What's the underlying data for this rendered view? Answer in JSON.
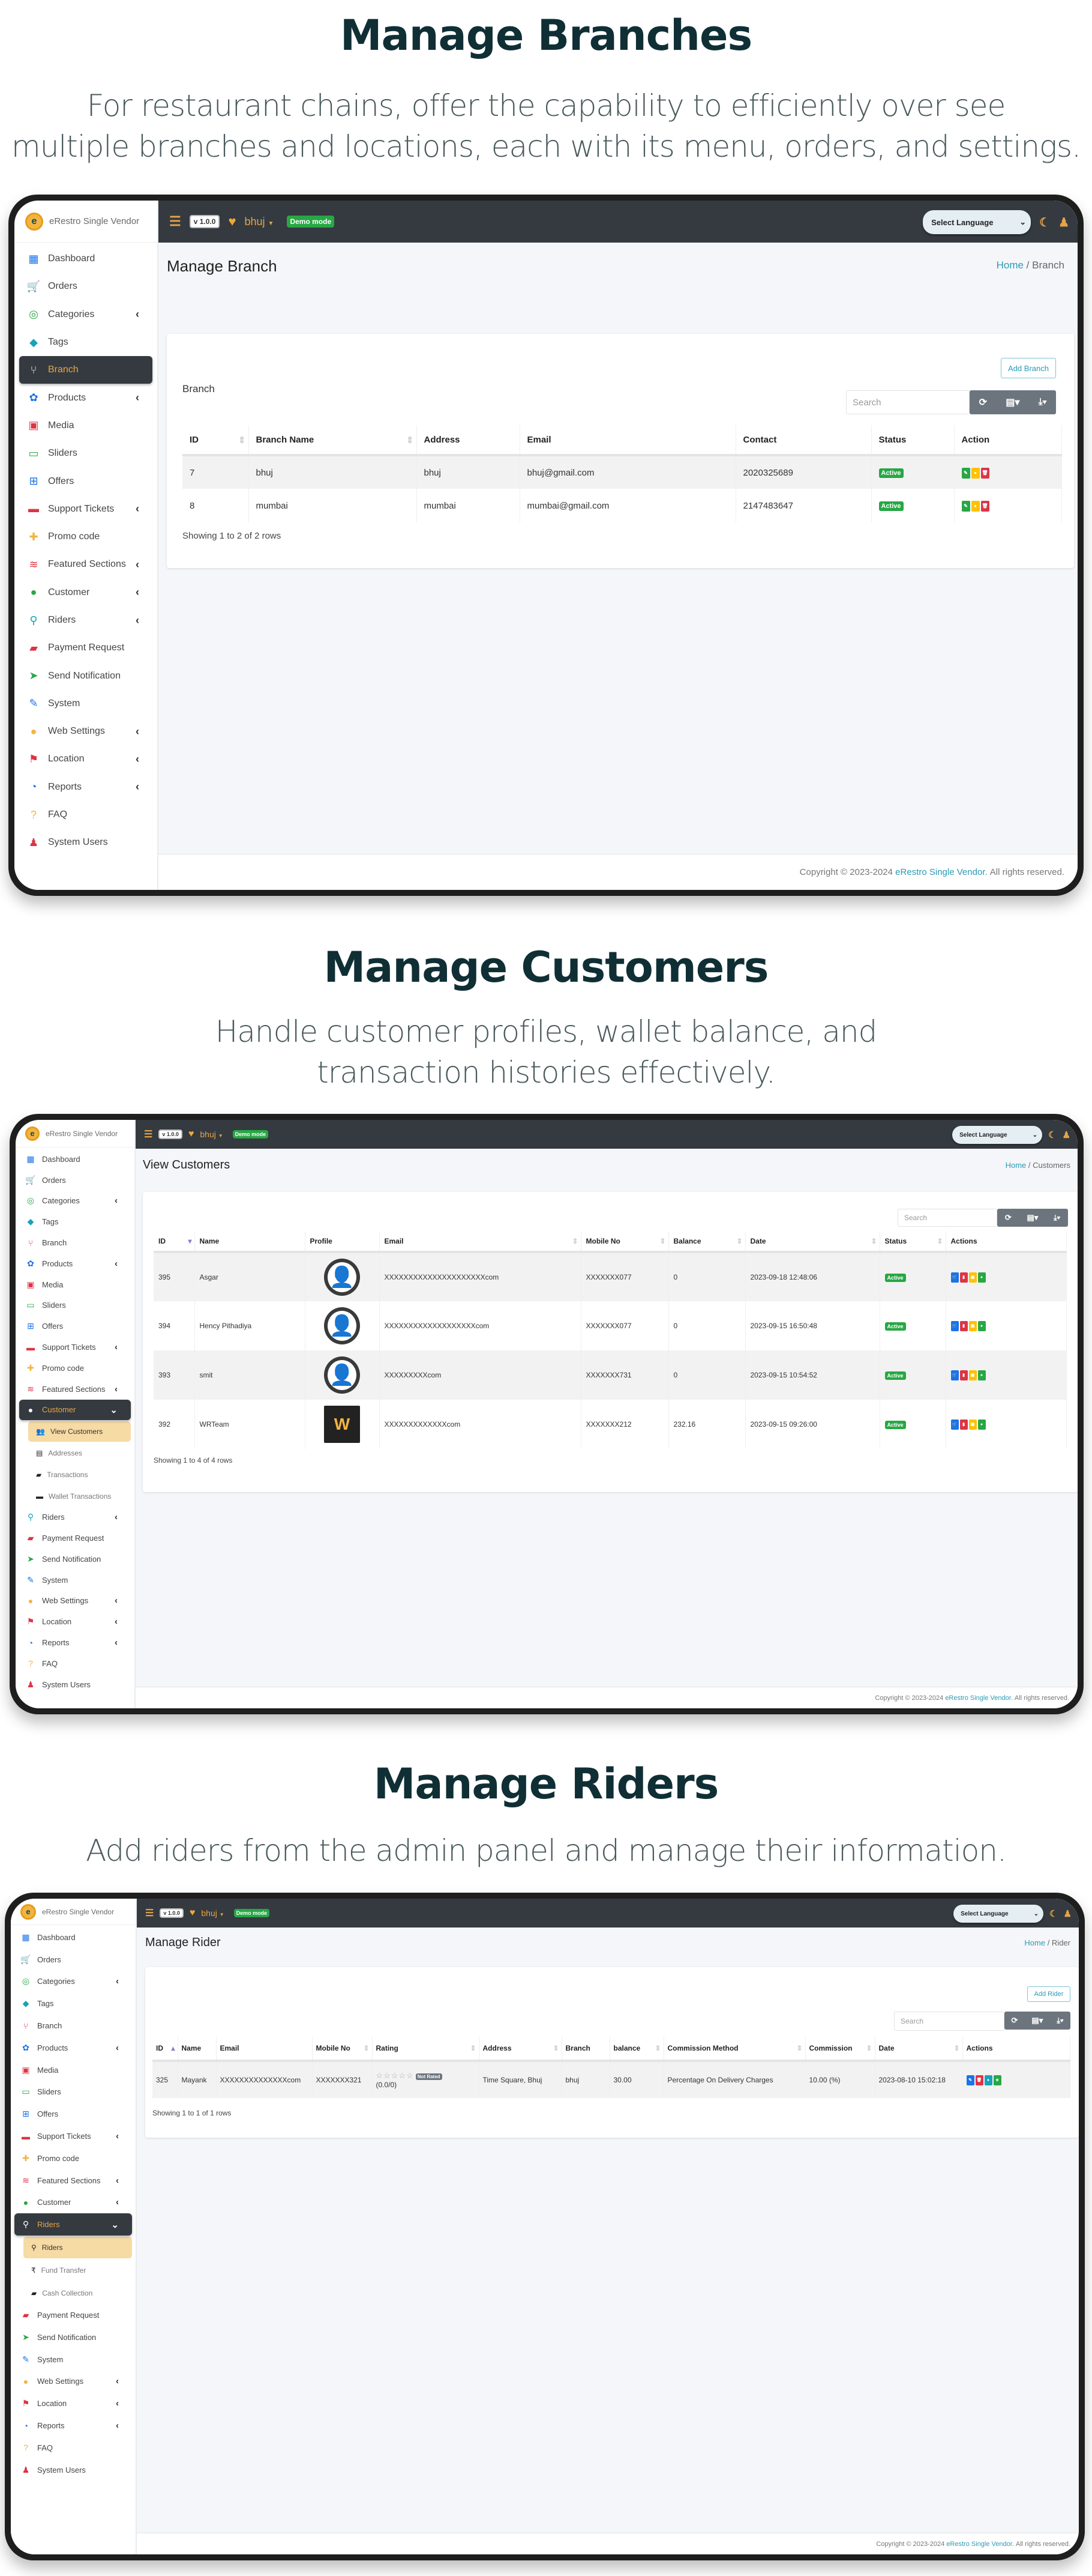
{
  "app": {
    "brand": "eRestro Single Vendor",
    "version": "v 1.0.0",
    "branch_selector": "bhuj",
    "demo_badge": "Demo mode",
    "language_select": "Select Language",
    "search_placeholder": "Search",
    "footer": {
      "prefix": "Copyright © 2023-2024",
      "link": "eRestro Single Vendor.",
      "suffix": "All rights reserved."
    },
    "colors": {
      "topbar": "#343a40",
      "accent": "#e6a446",
      "active_sub": "#f7dba4",
      "success": "#28a745",
      "link": "#2b9bb5"
    }
  },
  "sidebar_base": [
    {
      "label": "Dashboard",
      "icon": "dashboard-icon",
      "glyph": "▦",
      "color": "#1a73e8"
    },
    {
      "label": "Orders",
      "icon": "cart-icon",
      "glyph": "🛒",
      "color": "#f2b441"
    },
    {
      "label": "Categories",
      "icon": "bullseye-icon",
      "glyph": "◎",
      "color": "#28a745",
      "chevron": "‹"
    },
    {
      "label": "Tags",
      "icon": "tag-icon",
      "glyph": "◆",
      "color": "#17a2b8"
    },
    {
      "label": "Branch",
      "icon": "code-branch-icon",
      "glyph": "⑂",
      "color": "#dc3545"
    },
    {
      "label": "Products",
      "icon": "cubes-icon",
      "glyph": "✿",
      "color": "#1a73e8",
      "chevron": "‹"
    },
    {
      "label": "Media",
      "icon": "photo-video-icon",
      "glyph": "▣",
      "color": "#dc3545"
    },
    {
      "label": "Sliders",
      "icon": "image-icon",
      "glyph": "▭",
      "color": "#28a745"
    },
    {
      "label": "Offers",
      "icon": "gift-icon",
      "glyph": "⊞",
      "color": "#1a73e8"
    },
    {
      "label": "Support Tickets",
      "icon": "ticket-icon",
      "glyph": "▬",
      "color": "#dc3545",
      "chevron": "‹"
    },
    {
      "label": "Promo code",
      "icon": "puzzle-icon",
      "glyph": "✚",
      "color": "#f2b441"
    },
    {
      "label": "Featured Sections",
      "icon": "layer-group-icon",
      "glyph": "≋",
      "color": "#dc3545",
      "chevron": "‹"
    },
    {
      "label": "Customer",
      "icon": "user-icon",
      "glyph": "●",
      "color": "#28a745",
      "chevron": "‹"
    },
    {
      "label": "Riders",
      "icon": "motorcycle-icon",
      "glyph": "⚲",
      "color": "#17a2b8",
      "chevron": "‹"
    },
    {
      "label": "Payment Request",
      "icon": "money-bill-icon",
      "glyph": "▰",
      "color": "#dc3545"
    },
    {
      "label": "Send Notification",
      "icon": "paper-plane-icon",
      "glyph": "➤",
      "color": "#28a745"
    },
    {
      "label": "System",
      "icon": "wrench-icon",
      "glyph": "✎",
      "color": "#1a73e8"
    },
    {
      "label": "Web Settings",
      "icon": "globe-icon",
      "glyph": "●",
      "color": "#f2b441",
      "chevron": "‹"
    },
    {
      "label": "Location",
      "icon": "map-marked-icon",
      "glyph": "⚑",
      "color": "#dc3545",
      "chevron": "‹"
    },
    {
      "label": "Reports",
      "icon": "chart-pie-icon",
      "glyph": "◔",
      "color": "#1a73e8",
      "chevron": "‹"
    },
    {
      "label": "FAQ",
      "icon": "question-circle-icon",
      "glyph": "?",
      "color": "#f2b441"
    },
    {
      "label": "System Users",
      "icon": "user-tie-icon",
      "glyph": "♟",
      "color": "#dc3545"
    }
  ],
  "sections": [
    {
      "title": "Manage Branches",
      "subtitle_lines": [
        "For restaurant chains, offer the capability to efficiently over see",
        "multiple branches and locations, each with its menu, orders, and settings."
      ],
      "page_title": "Manage Branch",
      "breadcrumb": {
        "home": "Home",
        "current": "Branch"
      },
      "card_label": "Branch",
      "add_button": "Add Branch",
      "active_nav": "Branch",
      "columns": [
        "ID",
        "Branch Name",
        "Address",
        "Email",
        "Contact",
        "Status",
        "Action"
      ],
      "rows": [
        {
          "id": "7",
          "name": "bhuj",
          "address": "bhuj",
          "email": "bhuj@gmail.com",
          "contact": "2020325689",
          "status": "Active"
        },
        {
          "id": "8",
          "name": "mumbai",
          "address": "mumbai",
          "email": "mumbai@gmail.com",
          "contact": "2147483647",
          "status": "Active"
        }
      ],
      "showing": "Showing 1 to 2 of 2 rows"
    },
    {
      "title": "Manage Customers",
      "subtitle_lines": [
        "Handle customer profiles, wallet balance, and",
        "transaction histories effectively."
      ],
      "page_title": "View Customers",
      "breadcrumb": {
        "home": "Home",
        "current": "Customers"
      },
      "active_nav": "Customer",
      "submenu": [
        {
          "label": "View Customers",
          "icon": "users-icon",
          "glyph": "👥",
          "active": true
        },
        {
          "label": "Addresses",
          "icon": "address-book-icon",
          "glyph": "▤"
        },
        {
          "label": "Transactions",
          "icon": "money-bill-icon",
          "glyph": "▰"
        },
        {
          "label": "Wallet Transactions",
          "icon": "wallet-icon",
          "glyph": "▬"
        }
      ],
      "columns": [
        "ID",
        "Name",
        "Profile",
        "Email",
        "Mobile No",
        "Balance",
        "Date",
        "Status",
        "Actions"
      ],
      "rows": [
        {
          "id": "395",
          "name": "Asgar",
          "profile": "default-avatar",
          "email": "XXXXXXXXXXXXXXXXXXXXXcom",
          "mobile": "XXXXXXX077",
          "balance": "0",
          "date": "2023-09-18 12:48:06",
          "status": "Active"
        },
        {
          "id": "394",
          "name": "Hency Pithadiya",
          "profile": "default-avatar",
          "email": "XXXXXXXXXXXXXXXXXXXcom",
          "mobile": "XXXXXXX077",
          "balance": "0",
          "date": "2023-09-15 16:50:48",
          "status": "Active"
        },
        {
          "id": "393",
          "name": "smit",
          "profile": "default-avatar",
          "email": "XXXXXXXXXcom",
          "mobile": "XXXXXXX731",
          "balance": "0",
          "date": "2023-09-15 10:54:52",
          "status": "Active"
        },
        {
          "id": "392",
          "name": "WRTeam",
          "profile": "wrteam-logo",
          "email": "XXXXXXXXXXXXXcom",
          "mobile": "XXXXXXX212",
          "balance": "232.16",
          "date": "2023-09-15 09:26:00",
          "status": "Active"
        }
      ],
      "showing": "Showing 1 to 4 of 4 rows"
    },
    {
      "title": "Manage Riders",
      "subtitle_lines": [
        "Add riders from the admin panel and manage their information."
      ],
      "page_title": "Manage Rider",
      "breadcrumb": {
        "home": "Home",
        "current": "Rider"
      },
      "add_button": "Add Rider",
      "active_nav": "Riders",
      "submenu": [
        {
          "label": "Riders",
          "icon": "motorcycle-icon",
          "glyph": "⚲",
          "active": true
        },
        {
          "label": "Fund Transfer",
          "icon": "rupee-icon",
          "glyph": "₹"
        },
        {
          "label": "Cash Collection",
          "icon": "money-bill-icon",
          "glyph": "▰"
        }
      ],
      "columns": [
        "ID",
        "Name",
        "Email",
        "Mobile No",
        "Rating",
        "Address",
        "Branch",
        "balance",
        "Commission Method",
        "Commission",
        "Date",
        "Actions"
      ],
      "rows": [
        {
          "id": "325",
          "name": "Mayank",
          "email": "XXXXXXXXXXXXXXcom",
          "mobile": "XXXXXXX321",
          "rating_stars": "☆☆☆☆☆",
          "rating_badge": "Not Rated",
          "rating_value": "(0.0/0)",
          "address": "Time Square, Bhuj",
          "branch": "bhuj",
          "balance": "30.00",
          "commission_method": "Percentage On Delivery Charges",
          "commission": "10.00 (%)",
          "date": "2023-08-10 15:02:18"
        }
      ],
      "showing": "Showing 1 to 1 of 1 rows"
    }
  ]
}
